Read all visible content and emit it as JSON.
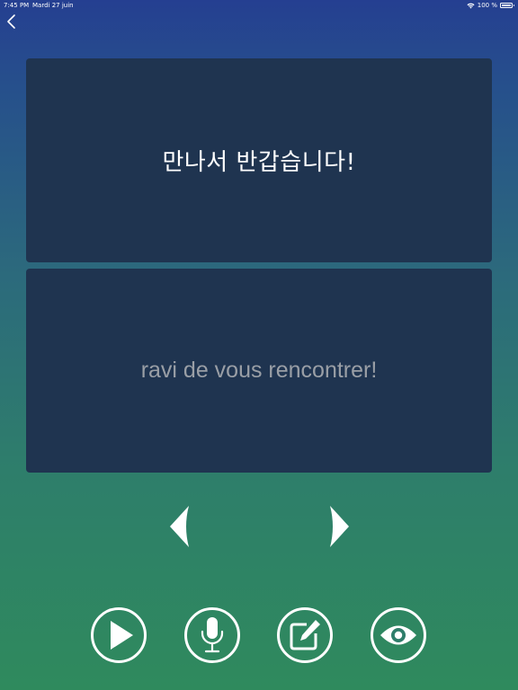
{
  "status_bar": {
    "time": "7:45 PM",
    "date": "Mardi 27 juin",
    "battery": "100 %",
    "wifi_icon": "wifi-icon",
    "battery_icon": "battery-icon"
  },
  "nav": {
    "back_icon": "chevron-left-icon"
  },
  "flashcard": {
    "front_text": "만나서 반갑습니다!",
    "back_text": "ravi de vous rencontrer!"
  },
  "navigation_arrows": {
    "prev_icon": "arrow-left-icon",
    "next_icon": "arrow-right-icon"
  },
  "controls": [
    {
      "icon": "play-icon"
    },
    {
      "icon": "microphone-icon"
    },
    {
      "icon": "edit-icon"
    },
    {
      "icon": "eye-icon"
    }
  ],
  "colors": {
    "card_background": "#1f3450",
    "gradient_top": "#253f91",
    "gradient_bottom": "#2f8a5d",
    "back_text_color": "#9a9fa6"
  }
}
